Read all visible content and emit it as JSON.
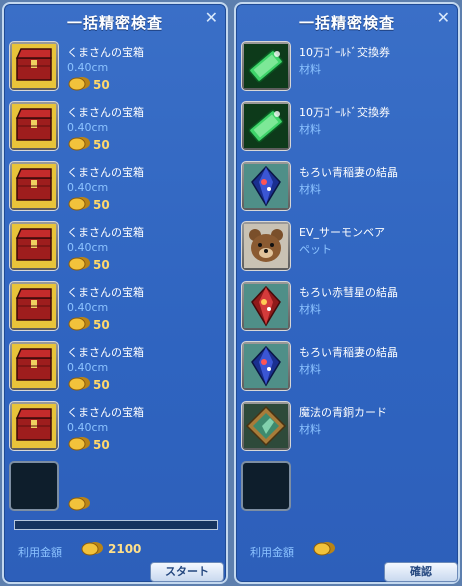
{
  "left_window": {
    "title": "一括精密検査",
    "items": [
      {
        "name": "くまさんの宝箱",
        "sub": "0.40cm",
        "price": "50",
        "icon": "treasure-chest-icon"
      },
      {
        "name": "くまさんの宝箱",
        "sub": "0.40cm",
        "price": "50",
        "icon": "treasure-chest-icon"
      },
      {
        "name": "くまさんの宝箱",
        "sub": "0.40cm",
        "price": "50",
        "icon": "treasure-chest-icon"
      },
      {
        "name": "くまさんの宝箱",
        "sub": "0.40cm",
        "price": "50",
        "icon": "treasure-chest-icon"
      },
      {
        "name": "くまさんの宝箱",
        "sub": "0.40cm",
        "price": "50",
        "icon": "treasure-chest-icon"
      },
      {
        "name": "くまさんの宝箱",
        "sub": "0.40cm",
        "price": "50",
        "icon": "treasure-chest-icon"
      },
      {
        "name": "くまさんの宝箱",
        "sub": "0.40cm",
        "price": "50",
        "icon": "treasure-chest-icon"
      }
    ],
    "fee_label": "利用金額",
    "fee_value": "2100",
    "progress": 0,
    "start_button": "スタート"
  },
  "right_window": {
    "title": "一括精密検査",
    "items": [
      {
        "name": "10万ｺﾞｰﾙﾄﾞ交換券",
        "sub": "材料",
        "icon": "gold-ticket-icon"
      },
      {
        "name": "10万ｺﾞｰﾙﾄﾞ交換券",
        "sub": "材料",
        "icon": "gold-ticket-icon"
      },
      {
        "name": "もろい青稲妻の結晶",
        "sub": "材料",
        "icon": "blue-crystal-icon"
      },
      {
        "name": "EV_サーモンベア",
        "sub": "ペット",
        "icon": "bear-pet-icon"
      },
      {
        "name": "もろい赤彗星の結晶",
        "sub": "材料",
        "icon": "red-crystal-icon"
      },
      {
        "name": "もろい青稲妻の結晶",
        "sub": "材料",
        "icon": "blue-crystal-icon"
      },
      {
        "name": "魔法の青銅カード",
        "sub": "材料",
        "icon": "bronze-card-icon"
      }
    ],
    "fee_label": "利用金額",
    "confirm_button": "確認"
  },
  "colors": {
    "panel_bg": "#3a6fc7",
    "panel_border": "#c3d8ef",
    "sub_text": "#8cc3ff",
    "price_text": "#ffd86a"
  }
}
